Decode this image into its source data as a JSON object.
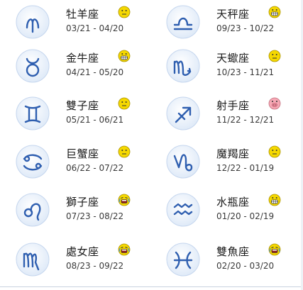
{
  "signs": [
    {
      "name": "牡羊座",
      "range": "03/21 - 04/20",
      "icon": "aries-icon",
      "mood": "neutral"
    },
    {
      "name": "天秤座",
      "range": "09/23 - 10/22",
      "icon": "libra-icon",
      "mood": "grin"
    },
    {
      "name": "金牛座",
      "range": "04/21 - 05/20",
      "icon": "taurus-icon",
      "mood": "grin"
    },
    {
      "name": "天蠍座",
      "range": "10/23 - 11/21",
      "icon": "scorpio-icon",
      "mood": "neutral"
    },
    {
      "name": "雙子座",
      "range": "05/21 - 06/21",
      "icon": "gemini-icon",
      "mood": "neutral"
    },
    {
      "name": "射手座",
      "range": "11/22 - 12/21",
      "icon": "sagittarius-icon",
      "mood": "pig"
    },
    {
      "name": "巨蟹座",
      "range": "06/22 - 07/22",
      "icon": "cancer-icon",
      "mood": "neutral"
    },
    {
      "name": "魔羯座",
      "range": "12/22 - 01/19",
      "icon": "capricorn-icon",
      "mood": "neutral"
    },
    {
      "name": "獅子座",
      "range": "07/23 - 08/22",
      "icon": "leo-icon",
      "mood": "cry"
    },
    {
      "name": "水瓶座",
      "range": "01/20 - 02/19",
      "icon": "aquarius-icon",
      "mood": "grin"
    },
    {
      "name": "處女座",
      "range": "08/23 - 09/22",
      "icon": "virgo-icon",
      "mood": "cry"
    },
    {
      "name": "雙魚座",
      "range": "02/20 - 03/20",
      "icon": "pisces-icon",
      "mood": "cry"
    }
  ],
  "colors": {
    "badge_fill": "#dfeaf8",
    "badge_stroke": "#2f5fb0",
    "smiley_yellow": "#f5d800",
    "smiley_pink": "#f7a8b5"
  }
}
